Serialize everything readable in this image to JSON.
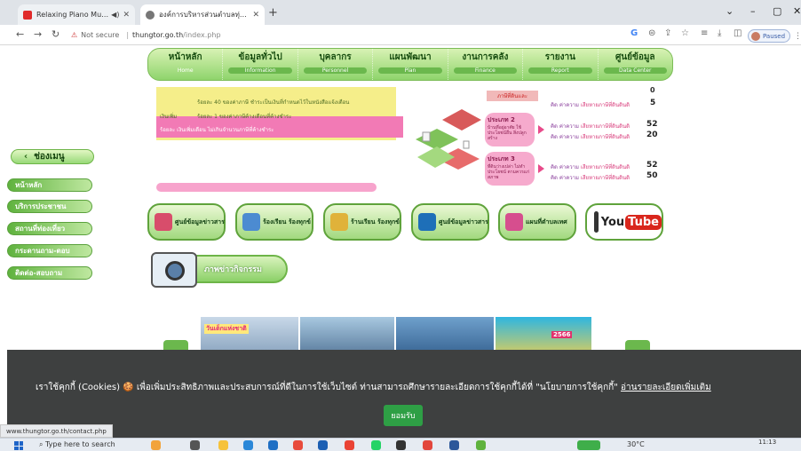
{
  "browser": {
    "tabs": [
      {
        "title": "Relaxing Piano Music: Roma",
        "audio": "◀)",
        "close": "✕"
      },
      {
        "title": "องค์การบริหารส่วนตำบลทุ่งต่อ อำเภอ",
        "close": "✕"
      }
    ],
    "new_tab": "+",
    "address": {
      "security": "Not secure",
      "domain": "thungtor.go.th",
      "path": "/index.php"
    },
    "profile_status": "Paused"
  },
  "nav_menu": [
    {
      "th": "หน้าหลัก",
      "en": "Home"
    },
    {
      "th": "ข้อมูลทั่วไป",
      "en": "Information"
    },
    {
      "th": "บุคลากร",
      "en": "Personnel"
    },
    {
      "th": "แผนพัฒนา",
      "en": "Plan"
    },
    {
      "th": "งานการคลัง",
      "en": "Finance"
    },
    {
      "th": "รายงาน",
      "en": "Report"
    },
    {
      "th": "ศูนย์ข้อมูล",
      "en": "Data Center"
    }
  ],
  "hero": {
    "line1": "ร้อยละ 40 ของค่าภาษี ชำระเป็นเงินที่กำหนดไว้ในหนังสือแจ้งเตือน",
    "line2_label": "เงินเพิ่ม",
    "line2": "ร้อยละ 1 ของค่าภาษีค้างเดือนที่ค้างชำระ",
    "line3": "ร้อยละ  เงินเพิ่มเดือน ไม่เกินจำนวนภาษีที่ค้างชำระ",
    "counts_top": "0",
    "count_row1": "5",
    "box1_title": "ประเภท 2",
    "box1_text": "บ้านที่อยู่อาศัย ใช้ประโยชน์อื่น สิ่งปลูกสร้าง",
    "box2_title": "ประเภท 3",
    "box2_text": "ที่ดินว่างเปล่า ไม่ทำประโยชน์ ตามควรแก่สภาพ",
    "rows": [
      {
        "label": "คิด ค่าความ",
        "hi": "เสียหายภาษีที่ดินดินดิ",
        "value": "5"
      },
      {
        "label": "คิด ค่าความ",
        "hi": "เสียหายภาษีที่ดินดินดิ",
        "value": "52"
      },
      {
        "label": "คิด ค่าความ",
        "hi": "เสียหายภาษีที่ดินดินดิ",
        "value": "20"
      },
      {
        "label": "คิด ค่าความ",
        "hi": "เสียหายภาษีที่ดินดินดิ",
        "value": "52"
      },
      {
        "label": "คิด ค่าความ",
        "hi": "เสียหายภาษีที่ดินดินดิ",
        "value": "50"
      }
    ],
    "red_tag": "ภาษีที่ดินและ"
  },
  "sidebar": {
    "title": "ช่องเมนู",
    "items": [
      "หน้าหลัก",
      "บริการประชาชน",
      "สถานที่ท่องเที่ยว",
      "กระดานถาม-ตอบ",
      "ติดต่อ-สอบถาม"
    ]
  },
  "quick_links": [
    {
      "label": "ศูนย์ข้อมูลข่าวสาร",
      "color": "#d84d6b"
    },
    {
      "label": "ร้องเรียน ร้องทุกข์",
      "color": "#4c8bd1"
    },
    {
      "label": "ร้านเรียน ร้องทุกข์",
      "color": "#e0b23a"
    },
    {
      "label": "ศูนย์ข้อมูลข่าวสาร",
      "color": "#1e6fb8"
    },
    {
      "label": "แผนที่ตำบลเทศ",
      "color": "#d64e8e"
    }
  ],
  "youtube": {
    "you": "You",
    "tube": "Tube"
  },
  "gallery_label": "ภาพข่าวกิจกรรม",
  "banner": {
    "text1": "วันเด็กแห่งชาติ",
    "text2": "2566"
  },
  "cookie": {
    "message": "เราใช้คุกกี้ (Cookies) 🍪 เพื่อเพิ่มประสิทธิภาพและประสบการณ์ที่ดีในการใช้เว็บไซต์ ท่านสามารถศึกษารายละเอียดการใช้คุกกี้ได้ที่ \"นโยบายการใช้คุกกี้\"",
    "link": "อ่านรายละเอียดเพิ่มเติม",
    "accept": "ยอมรับ"
  },
  "status_url": "www.thungtor.go.th/contact.php",
  "taskbar": {
    "search": "Type here to search",
    "weather": "30°C",
    "time": "11:13"
  }
}
